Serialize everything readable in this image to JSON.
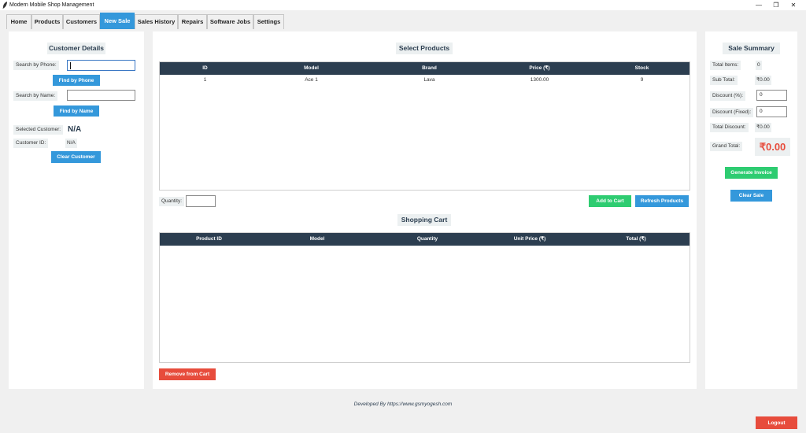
{
  "window": {
    "title": "Modern Mobile Shop Management",
    "controls": {
      "minimize": "—",
      "maximize": "❐",
      "close": "✕"
    }
  },
  "tabs": [
    {
      "label": "Home"
    },
    {
      "label": "Products"
    },
    {
      "label": "Customers"
    },
    {
      "label": "New Sale"
    },
    {
      "label": "Sales History"
    },
    {
      "label": "Repairs"
    },
    {
      "label": "Software Jobs"
    },
    {
      "label": "Settings"
    }
  ],
  "active_tab": "New Sale",
  "customer": {
    "heading": "Customer Details",
    "phone_label": "Search by Phone:",
    "phone_value": "",
    "find_phone_button": "Find by Phone",
    "name_label": "Search by Name:",
    "name_value": "",
    "find_name_button": "Find by Name",
    "selected_label": "Selected Customer:",
    "selected_value": "N/A",
    "id_label": "Customer ID:",
    "id_value": "N/A",
    "clear_button": "Clear Customer"
  },
  "products": {
    "heading": "Select Products",
    "columns": [
      "ID",
      "Model",
      "Brand",
      "Price (₹)",
      "Stock"
    ],
    "rows": [
      [
        "1",
        "Ace 1",
        "Lava",
        "1300.00",
        "9"
      ]
    ],
    "quantity_label": "Quantity:",
    "quantity_value": "",
    "add_button": "Add to Cart",
    "refresh_button": "Refresh Products"
  },
  "cart": {
    "heading": "Shopping Cart",
    "columns": [
      "Product ID",
      "Model",
      "Quantity",
      "Unit Price (₹)",
      "Total (₹)"
    ],
    "rows": [],
    "remove_button": "Remove from Cart"
  },
  "summary": {
    "heading": "Sale Summary",
    "total_items_label": "Total Items:",
    "total_items_value": "0",
    "subtotal_label": "Sub Total:",
    "subtotal_value": "₹0.00",
    "discount_pct_label": "Discount (%):",
    "discount_pct_value": "0",
    "discount_fixed_label": "Discount (Fixed):",
    "discount_fixed_value": "0",
    "total_discount_label": "Total Discount:",
    "total_discount_value": "₹0.00",
    "grand_total_label": "Grand Total:",
    "grand_total_value": "₹0.00",
    "generate_button": "Generate Invoice",
    "clear_button": "Clear Sale"
  },
  "footer": {
    "credit": "Developed By https://www.gsmyogesh.com"
  },
  "logout_button": "Logout",
  "colors": {
    "accent_blue": "#3498db",
    "success_green": "#2ecc71",
    "danger_red": "#e74c3c",
    "header_dark": "#2c3e50",
    "label_bg": "#ecf0f1"
  },
  "icons": {
    "app": "feather-quill-icon"
  }
}
